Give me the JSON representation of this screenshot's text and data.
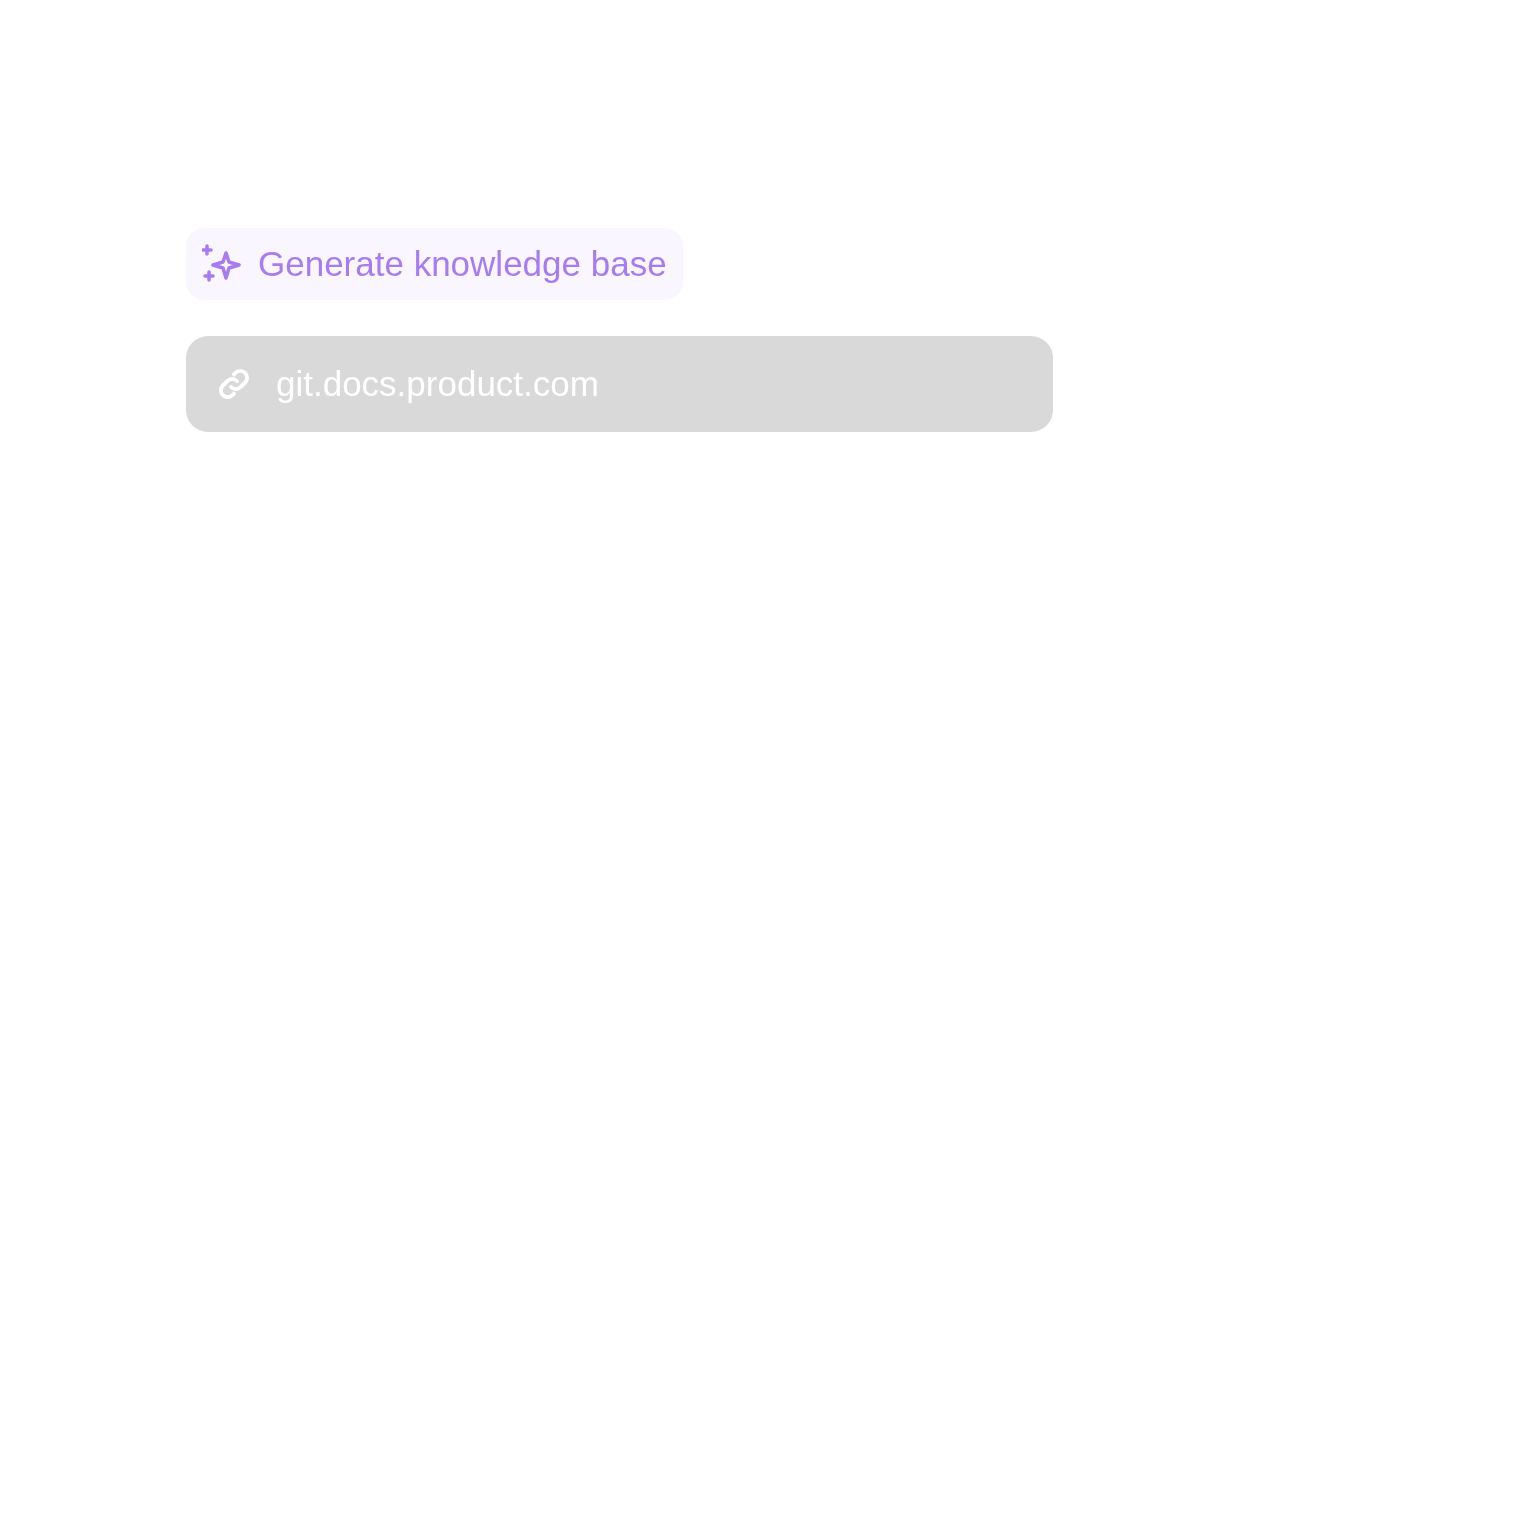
{
  "generate_button": {
    "label": "Generate knowledge base"
  },
  "url_field": {
    "value": "git.docs.product.com"
  }
}
